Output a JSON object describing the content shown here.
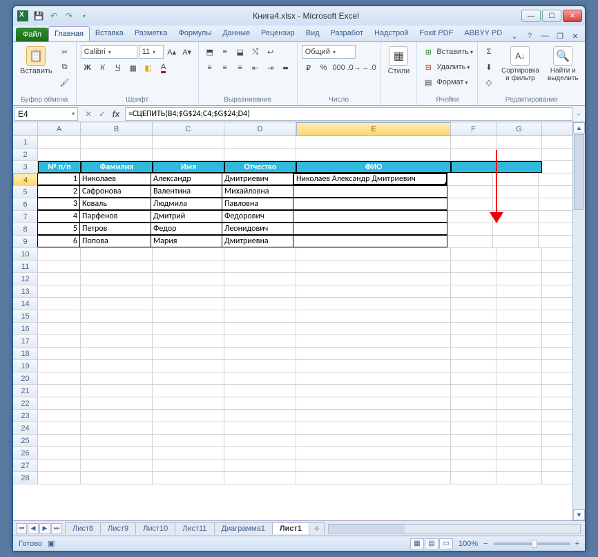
{
  "window": {
    "title_doc": "Книга4.xlsx",
    "title_app": "Microsoft Excel"
  },
  "qat": {
    "save": "💾",
    "undo": "↶",
    "redo": "↷"
  },
  "tabs": {
    "file": "Файл",
    "items": [
      "Главная",
      "Вставка",
      "Разметка",
      "Формулы",
      "Данные",
      "Рецензир",
      "Вид",
      "Разработ",
      "Надстрой",
      "Foxit PDF",
      "ABBYY PD"
    ],
    "active_index": 0
  },
  "ribbon": {
    "clipboard": {
      "paste": "Вставить",
      "label": "Буфер обмена"
    },
    "font": {
      "name": "Calibri",
      "size": "11",
      "bold": "Ж",
      "italic": "К",
      "underline": "Ч",
      "label": "Шрифт"
    },
    "alignment": {
      "label": "Выравнивание"
    },
    "number": {
      "format": "Общий",
      "label": "Число"
    },
    "styles": {
      "btn": "Стили",
      "label": ""
    },
    "cells": {
      "insert": "Вставить",
      "delete": "Удалить",
      "format": "Формат",
      "label": "Ячейки"
    },
    "editing": {
      "sort": "Сортировка\nи фильтр",
      "find": "Найти и\nвыделить",
      "label": "Редактирование"
    }
  },
  "namebox": "E4",
  "formula": "=СЦЕПИТЬ(B4;$G$24;C4;$G$24;D4)",
  "columns": [
    "A",
    "B",
    "C",
    "D",
    "E",
    "F",
    "G"
  ],
  "selected_col": "E",
  "selected_row": 4,
  "rows_count": 28,
  "table": {
    "header_row": 3,
    "headers": {
      "A": "№ п/п",
      "B": "Фамилия",
      "C": "Имя",
      "D": "Отчество",
      "E": "ФИО"
    },
    "data": [
      {
        "A": "1",
        "B": "Николаев",
        "C": "Александр",
        "D": "Дмитриевич",
        "E": "Николаев Александр Дмитриевич"
      },
      {
        "A": "2",
        "B": "Сафронова",
        "C": "Валентина",
        "D": "Михайловна",
        "E": ""
      },
      {
        "A": "3",
        "B": "Коваль",
        "C": "Людмила",
        "D": "Павловна",
        "E": ""
      },
      {
        "A": "4",
        "B": "Парфенов",
        "C": "Дмитрий",
        "D": "Федорович",
        "E": ""
      },
      {
        "A": "5",
        "B": "Петров",
        "C": "Федор",
        "D": "Леонидович",
        "E": ""
      },
      {
        "A": "6",
        "B": "Попова",
        "C": "Мария",
        "D": "Дмитриевна",
        "E": ""
      }
    ]
  },
  "sheets": {
    "nav": [
      "⏮",
      "◀",
      "▶",
      "⏭"
    ],
    "tabs": [
      "Лист8",
      "Лист9",
      "Лист10",
      "Лист11",
      "Диаграмма1",
      "Лист1"
    ],
    "active_index": 5
  },
  "status": {
    "ready": "Готово",
    "zoom": "100%"
  }
}
